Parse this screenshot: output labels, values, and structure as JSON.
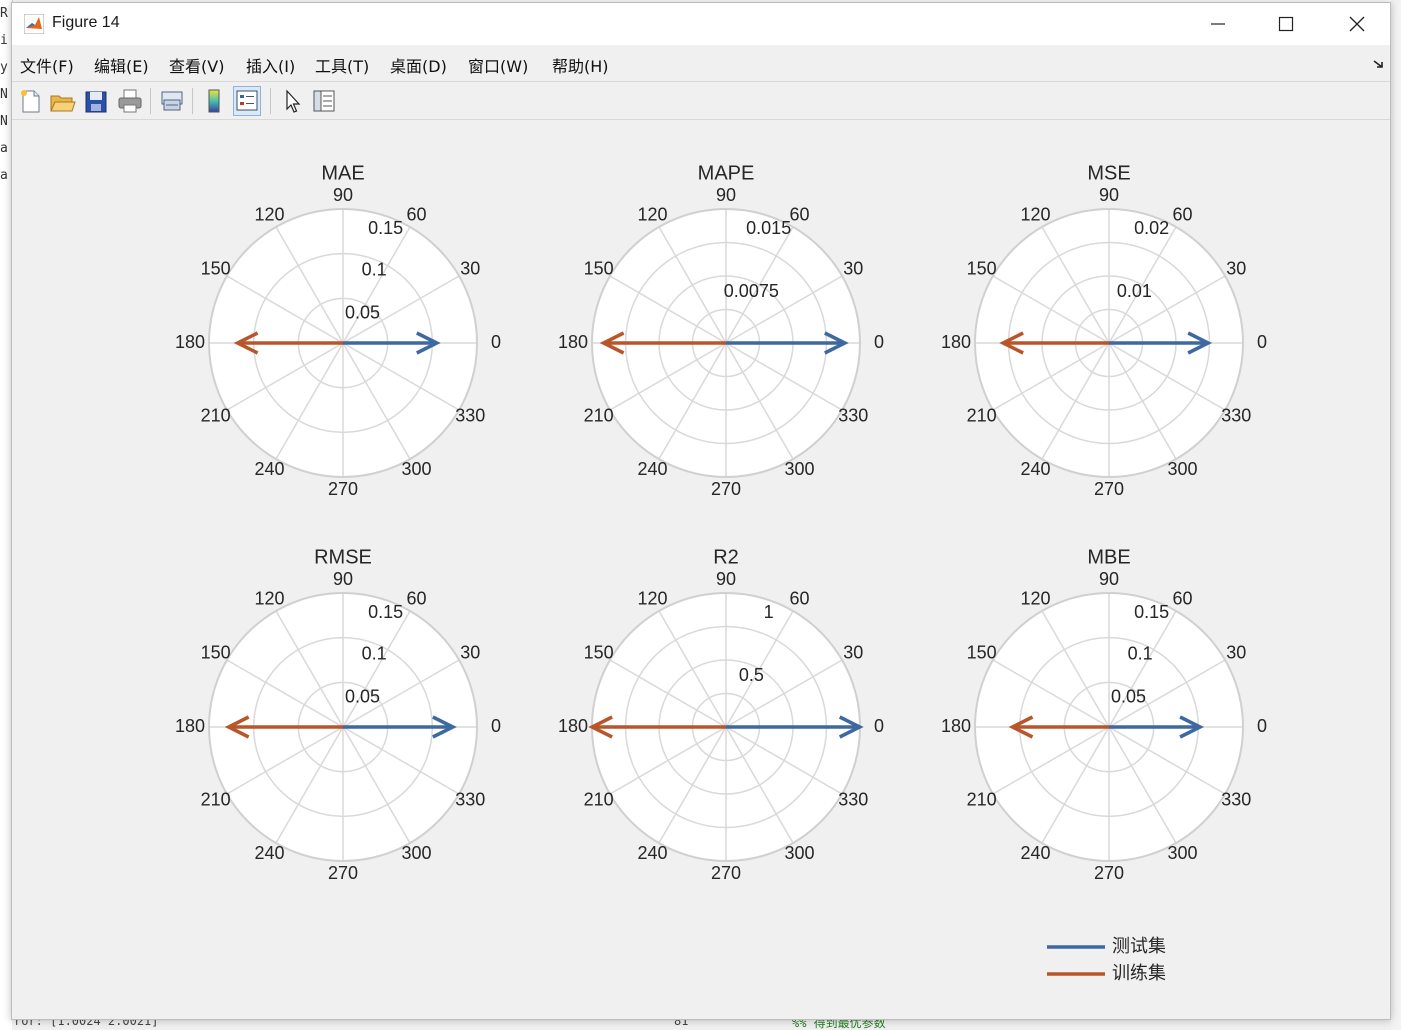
{
  "window": {
    "title": "Figure 14"
  },
  "menu": [
    {
      "label": "文件(F)"
    },
    {
      "label": "编辑(E)"
    },
    {
      "label": "查看(V)"
    },
    {
      "label": "插入(I)"
    },
    {
      "label": "工具(T)"
    },
    {
      "label": "桌面(D)"
    },
    {
      "label": "窗口(W)"
    },
    {
      "label": "帮助(H)"
    }
  ],
  "toolbar": [
    {
      "icon": "new-figure-icon"
    },
    {
      "icon": "open-file-icon"
    },
    {
      "icon": "save-icon"
    },
    {
      "icon": "print-icon"
    },
    {
      "icon": "link-plot-icon"
    },
    {
      "icon": "insert-colorbar-icon"
    },
    {
      "icon": "insert-legend-icon",
      "active": true
    },
    {
      "icon": "edit-plot-pointer-icon"
    },
    {
      "icon": "property-inspector-icon"
    }
  ],
  "background": {
    "bottom_text": "ror: [1.0024 2.0021]",
    "bottom_number": "81",
    "bottom_comment": "%%  得到最优参数"
  },
  "colors": {
    "test": "#3e68a2",
    "train": "#b8552a",
    "grid": "#d9d9d9",
    "axes_bg": "#ffffff",
    "figure_bg": "#f0f0f0"
  },
  "chart_data": [
    {
      "type": "compass",
      "title": "MAE",
      "rmax": 0.15,
      "ring_labels": [
        "0.05",
        "0.1",
        "0.15"
      ],
      "angle_labels": [
        "0",
        "30",
        "60",
        "90",
        "120",
        "150",
        "180",
        "210",
        "240",
        "270",
        "300",
        "330"
      ],
      "series": [
        {
          "name": "测试集",
          "angle": 0,
          "value": 0.105
        },
        {
          "name": "训练集",
          "angle": 180,
          "value": 0.118
        }
      ]
    },
    {
      "type": "compass",
      "title": "MAPE",
      "rmax": 0.015,
      "ring_labels": [
        "0.0075",
        "0.015"
      ],
      "angle_labels": [
        "0",
        "30",
        "60",
        "90",
        "120",
        "150",
        "180",
        "210",
        "240",
        "270",
        "300",
        "330"
      ],
      "series": [
        {
          "name": "测试集",
          "angle": 0,
          "value": 0.0133
        },
        {
          "name": "训练集",
          "angle": 180,
          "value": 0.0137
        }
      ]
    },
    {
      "type": "compass",
      "title": "MSE",
      "rmax": 0.02,
      "ring_labels": [
        "0.01",
        "0.02"
      ],
      "angle_labels": [
        "0",
        "30",
        "60",
        "90",
        "120",
        "150",
        "180",
        "210",
        "240",
        "270",
        "300",
        "330"
      ],
      "series": [
        {
          "name": "测试集",
          "angle": 0,
          "value": 0.0148
        },
        {
          "name": "训练集",
          "angle": 180,
          "value": 0.0158
        }
      ]
    },
    {
      "type": "compass",
      "title": "RMSE",
      "rmax": 0.15,
      "ring_labels": [
        "0.05",
        "0.1",
        "0.15"
      ],
      "angle_labels": [
        "0",
        "30",
        "60",
        "90",
        "120",
        "150",
        "180",
        "210",
        "240",
        "270",
        "300",
        "330"
      ],
      "series": [
        {
          "name": "测试集",
          "angle": 0,
          "value": 0.123
        },
        {
          "name": "训练集",
          "angle": 180,
          "value": 0.128
        }
      ]
    },
    {
      "type": "compass",
      "title": "R2",
      "rmax": 1,
      "ring_labels": [
        "0.5",
        "1"
      ],
      "angle_labels": [
        "0",
        "30",
        "60",
        "90",
        "120",
        "150",
        "180",
        "210",
        "240",
        "270",
        "300",
        "330"
      ],
      "series": [
        {
          "name": "测试集",
          "angle": 0,
          "value": 0.998
        },
        {
          "name": "训练集",
          "angle": 180,
          "value": 0.999
        }
      ]
    },
    {
      "type": "compass",
      "title": "MBE",
      "rmax": 0.15,
      "ring_labels": [
        "0.05",
        "0.1",
        "0.15"
      ],
      "angle_labels": [
        "0",
        "30",
        "60",
        "90",
        "120",
        "150",
        "180",
        "210",
        "240",
        "270",
        "300",
        "330"
      ],
      "series": [
        {
          "name": "测试集",
          "angle": 0,
          "value": 0.102
        },
        {
          "name": "训练集",
          "angle": 180,
          "value": 0.108
        }
      ]
    }
  ],
  "legend": {
    "placement": "bottom-right",
    "items": [
      {
        "label": "测试集",
        "color": "#3e68a2"
      },
      {
        "label": "训练集",
        "color": "#b8552a"
      }
    ]
  }
}
